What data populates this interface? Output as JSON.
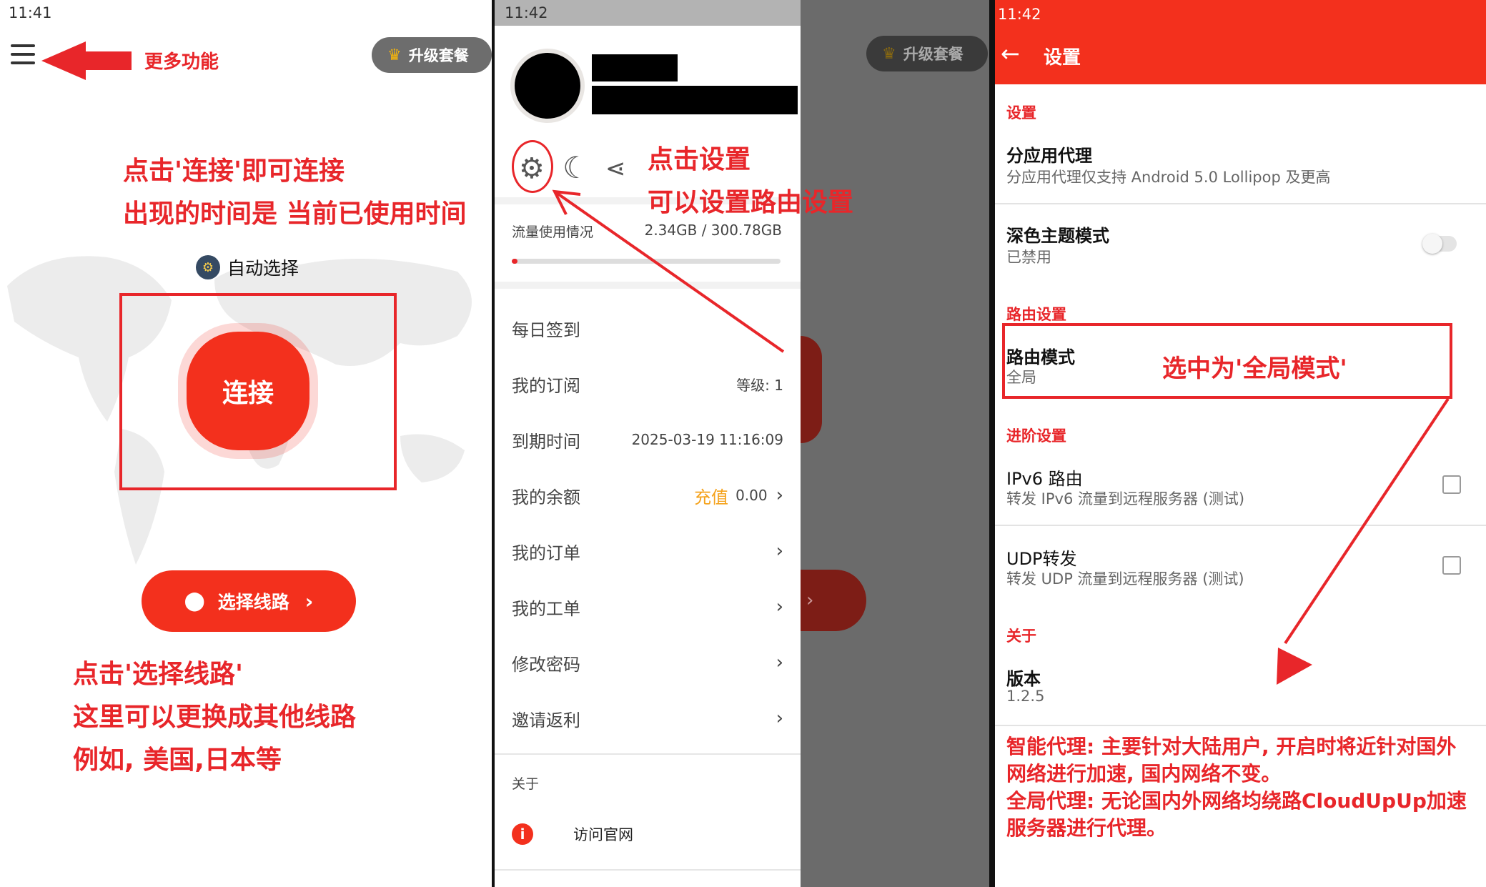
{
  "panel1": {
    "status_time": "11:41",
    "more_features": "更多功能",
    "upgrade_label": "升级套餐",
    "annotation_connect_line1": "点击'连接'即可连接",
    "annotation_connect_line2": "出现的时间是 当前已使用时间",
    "auto_select_label": "自动选择",
    "connect_label": "连接",
    "route_label": "选择线路",
    "annotation_route_line1": "点击'选择线路'",
    "annotation_route_line2": "这里可以更换成其他线路",
    "annotation_route_line3": "例如, 美国,日本等"
  },
  "panel2": {
    "status_time": "11:42",
    "annotation_settings_line1": "点击设置",
    "annotation_settings_line2": "可以设置路由设置",
    "traffic_label": "流量使用情况",
    "traffic_value": "2.34GB / 300.78GB",
    "traffic_used_fraction": 0.008,
    "menu": [
      {
        "label": "每日签到"
      },
      {
        "label": "我的订阅",
        "value": "等级: 1"
      },
      {
        "label": "到期时间",
        "value": "2025-03-19 11:16:09"
      },
      {
        "label": "我的余额",
        "recharge": "充值",
        "value": "0.00",
        "chevron": true
      },
      {
        "label": "我的订单",
        "chevron": true
      },
      {
        "label": "我的工单",
        "chevron": true
      },
      {
        "label": "修改密码",
        "chevron": true
      },
      {
        "label": "邀请返利",
        "chevron": true
      }
    ],
    "about_label": "关于",
    "visit_label": "访问官网",
    "bg_upgrade_label": "升级套餐"
  },
  "panel3": {
    "status_time": "11:42",
    "title": "设置",
    "section_settings": "设置",
    "per_app_title": "分应用代理",
    "per_app_sub": "分应用代理仅支持 Android 5.0 Lollipop 及更高",
    "dark_title": "深色主题模式",
    "dark_sub": "已禁用",
    "section_routing": "路由设置",
    "route_mode_title": "路由模式",
    "route_mode_sub": "全局",
    "annotation_route_mode": "选中为'全局模式'",
    "section_advanced": "进阶设置",
    "ipv6_title": "IPv6 路由",
    "ipv6_sub": "转发 IPv6 流量到远程服务器 (测试)",
    "udp_title": "UDP转发",
    "udp_sub": "转发 UDP 流量到远程服务器 (测试)",
    "section_about": "关于",
    "version_title": "版本",
    "version_value": "1.2.5",
    "note_line1": "智能代理: 主要针对大陆用户, 开启时将近针对国外",
    "note_line2": "网络进行加速, 国内网络不变。",
    "note_line3": "全局代理: 无论国内外网络均绕路CloudUpUp加速",
    "note_line4": "服务器进行代理。"
  },
  "colors": {
    "accent": "#f3301d",
    "annotation": "#e8262a",
    "recharge": "#f5a21b"
  }
}
